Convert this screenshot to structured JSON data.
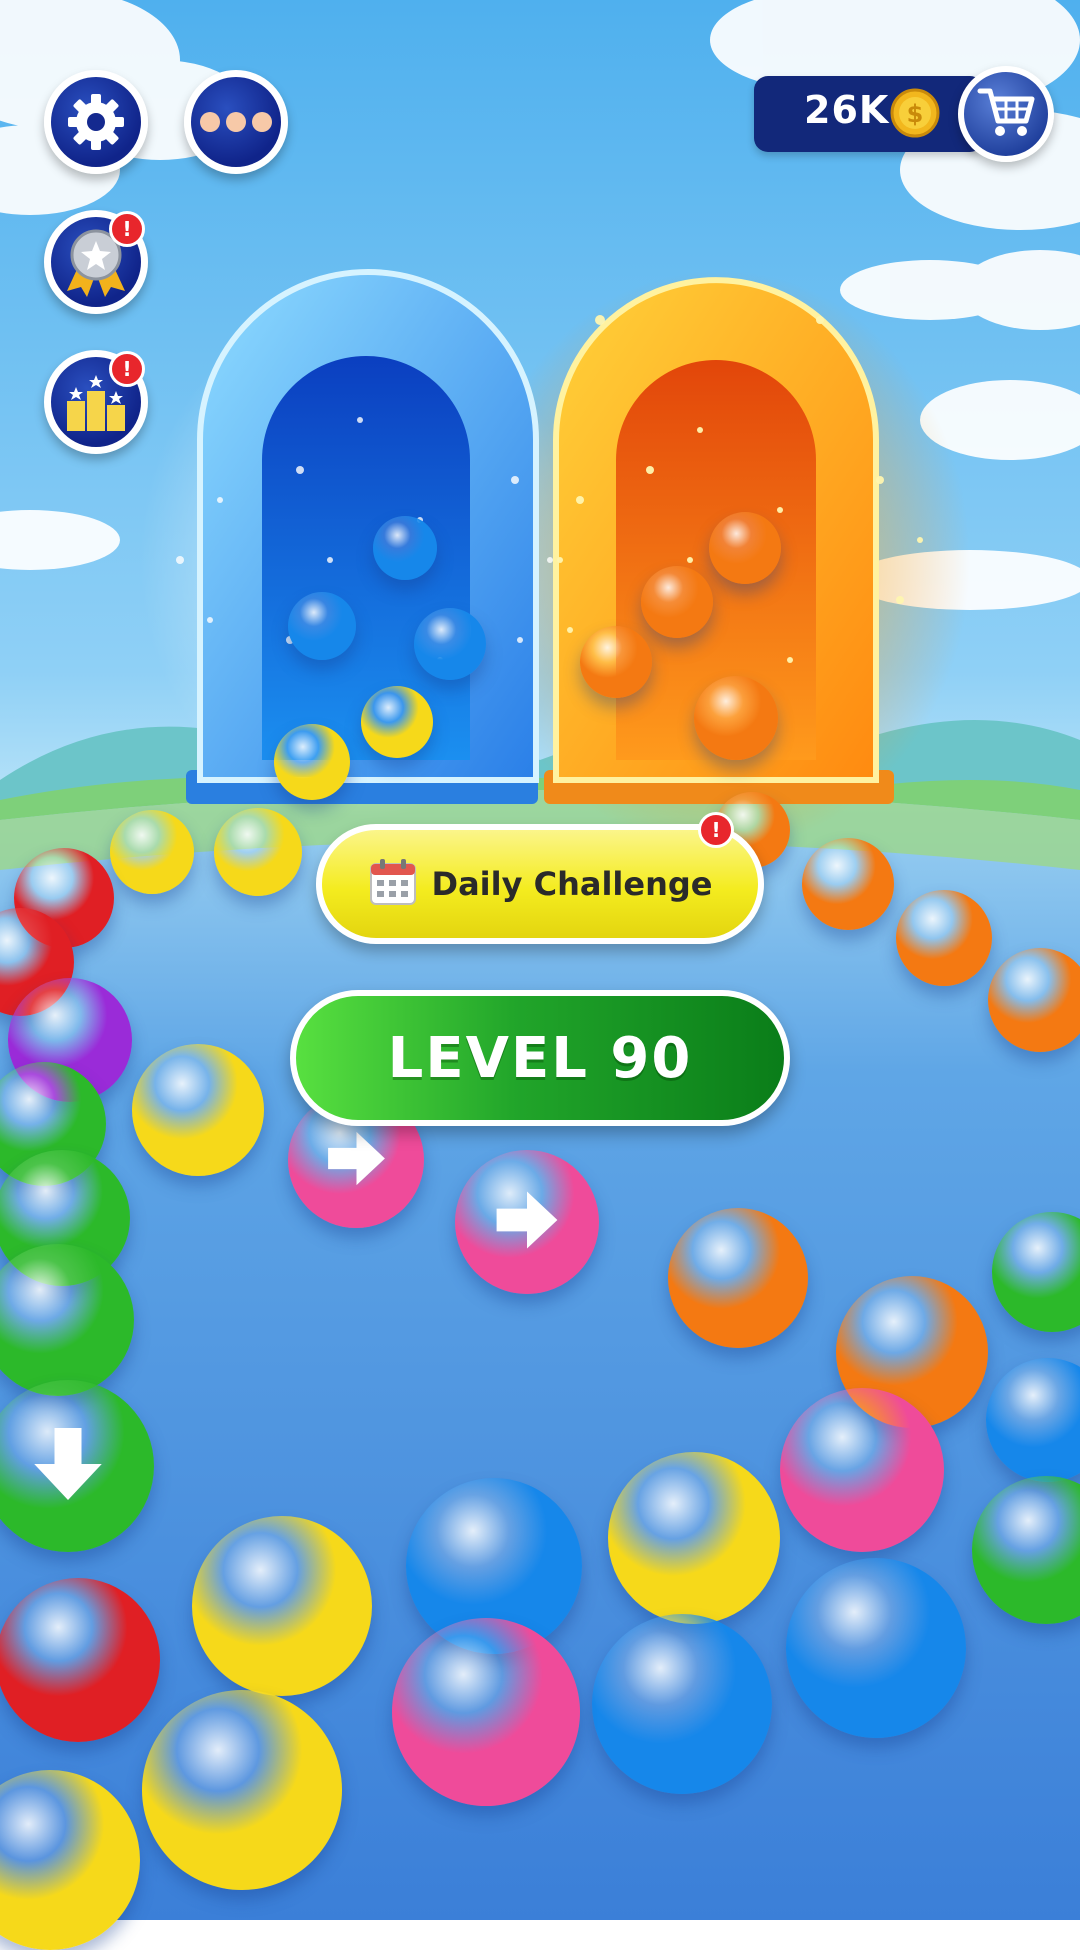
{
  "hud": {
    "settings_icon": "gear-icon",
    "more_icon": "more-dots-icon",
    "achievements_icon": "medal-icon",
    "achievements_alert": "!",
    "leaderboard_icon": "podium-icon",
    "leaderboard_alert": "!"
  },
  "currency": {
    "coins": "26K",
    "coin_icon": "coin-icon",
    "shop_icon": "cart-icon"
  },
  "daily_challenge": {
    "label": "Daily Challenge",
    "icon": "calendar-icon",
    "alert": "!"
  },
  "level": {
    "label": "LEVEL 90"
  },
  "portals": [
    {
      "name": "blue-portal",
      "color": "#1e73e8"
    },
    {
      "name": "orange-portal",
      "color": "#f57c10"
    }
  ],
  "path_markers": {
    "right_arrow_icon": "arrow-right-icon",
    "down_arrow_icon": "arrow-down-icon"
  },
  "colors": {
    "sky_top": "#5fb7ef",
    "ground": "#3f8fe0",
    "ball_red": "#e01f24",
    "ball_yellow": "#f6d91a",
    "ball_green": "#2cb92a",
    "ball_blue": "#1687ea",
    "ball_pink": "#ef4b9a",
    "ball_orange": "#f47912",
    "ball_purple": "#9a2bd8"
  }
}
